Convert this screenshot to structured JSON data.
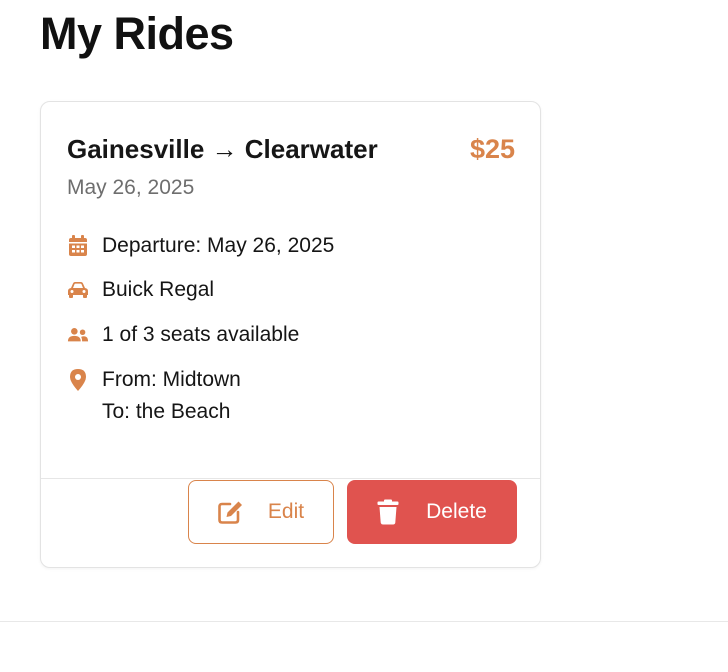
{
  "page": {
    "title": "My Rides"
  },
  "ride": {
    "route": "Gainesville → Clearwater",
    "price": "$25",
    "date": "May 26, 2025",
    "departure": "Departure: May 26, 2025",
    "vehicle": "Buick Regal",
    "seats": "1 of 3 seats available",
    "from": "From: Midtown",
    "to": "To: the Beach"
  },
  "actions": {
    "edit_label": "Edit",
    "delete_label": "Delete"
  },
  "icons": {
    "departure": "calendar-icon",
    "vehicle": "car-icon",
    "seats": "users-icon",
    "location": "map-pin-icon",
    "edit": "edit-icon",
    "delete": "trash-icon"
  },
  "colors": {
    "accent": "#d9844b",
    "danger": "#e0534f",
    "muted_text": "#6e6e6e",
    "border": "#e3e3e3"
  }
}
